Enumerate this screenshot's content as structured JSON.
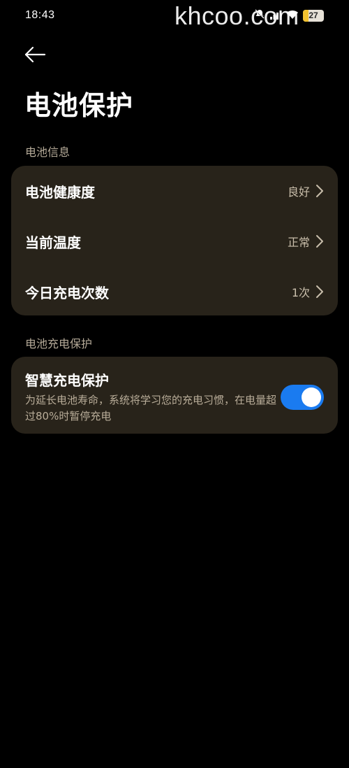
{
  "status_bar": {
    "time": "18:43",
    "battery_level": "27",
    "battery_fraction": 0.27,
    "icons": [
      "mute-icon",
      "signal-icon",
      "wifi-icon",
      "battery-icon"
    ]
  },
  "watermark": "khcoo.com",
  "header": {
    "back_icon": "arrow-left-icon",
    "title": "电池保护"
  },
  "sections": {
    "battery_info": {
      "header": "电池信息",
      "rows": [
        {
          "label": "电池健康度",
          "value": "良好"
        },
        {
          "label": "当前温度",
          "value": "正常"
        },
        {
          "label": "今日充电次数",
          "value": "1次"
        }
      ]
    },
    "charge_protect": {
      "header": "电池充电保护",
      "smart": {
        "title": "智慧充电保护",
        "description": "为延长电池寿命，系统将学习您的充电习惯，在电量超过80%时暂停充电",
        "enabled": true
      }
    }
  },
  "colors": {
    "background": "#000000",
    "card": "#28231a",
    "accent": "#1a7bf0",
    "section_header": "#b5aa98"
  }
}
